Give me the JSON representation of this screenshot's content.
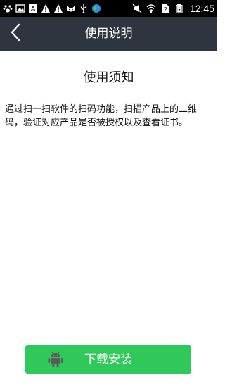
{
  "status_bar": {
    "time": "12:45",
    "left_icons": [
      "paw-icon",
      "image-icon",
      "a-icon",
      "warning-icon",
      "warning-icon",
      "cat-icon",
      "usb-icon",
      "globe-icon"
    ],
    "right_icons": [
      "no-sound-icon",
      "wifi-icon",
      "sim-icon",
      "battery-icon"
    ]
  },
  "header": {
    "back_icon": "back-chevron-icon",
    "title": "使用说明"
  },
  "main": {
    "heading": "使用须知",
    "body": "通过扫一扫软件的扫码功能，扫描产品上的二维码，验证对应产品是否被授权以及查看证书。"
  },
  "footer": {
    "install_label": "下载安装",
    "install_icon": "android-icon",
    "button_color": "#2fc85a"
  },
  "colors": {
    "header_bg": "#2e353f",
    "status_bg": "#000000"
  }
}
